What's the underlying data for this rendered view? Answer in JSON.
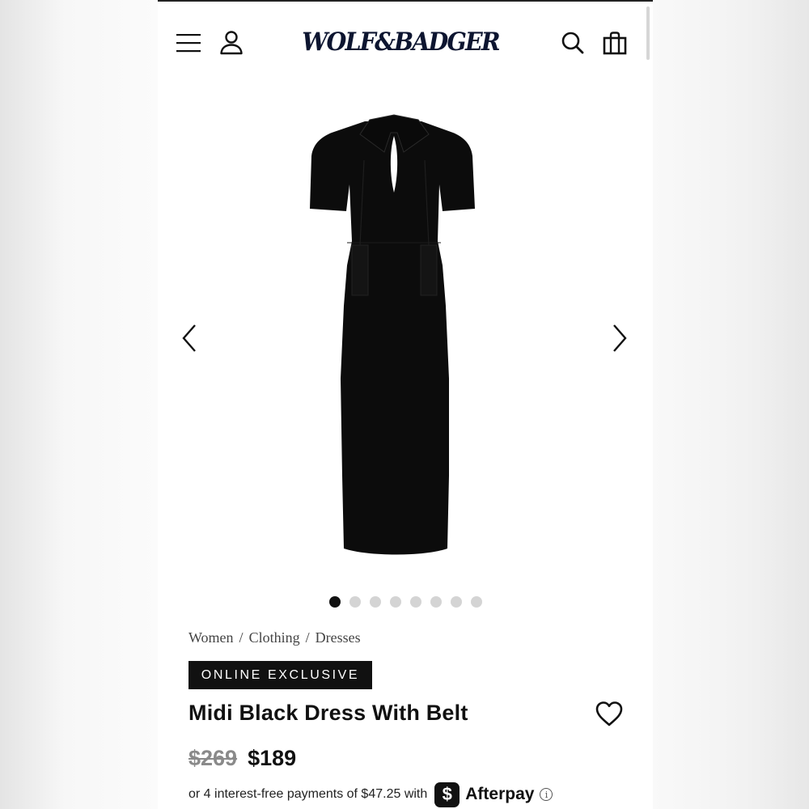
{
  "header": {
    "logo_text": "WOLF&BADGER",
    "menu_icon": "hamburger-menu-icon",
    "account_icon": "user-icon",
    "search_icon": "search-icon",
    "bag_icon": "shopping-bag-icon"
  },
  "carousel": {
    "image": "black midi dress with collar, keyhole neckline, short sleeves and waist belt",
    "prev_icon": "chevron-left-icon",
    "next_icon": "chevron-right-icon",
    "total_slides": 8,
    "active_slide": 1
  },
  "breadcrumb": {
    "items": [
      "Women",
      "Clothing",
      "Dresses"
    ],
    "separator": "/"
  },
  "product": {
    "badge": "ONLINE EXCLUSIVE",
    "title": "Midi Black Dress With Belt",
    "wishlist_icon": "heart-icon",
    "price_original": "$269",
    "price_sale": "$189"
  },
  "payment": {
    "text": "or 4 interest-free payments of $47.25 with",
    "badge_symbol": "$",
    "provider": "Afterpay",
    "info_icon_label": "i"
  },
  "colors": {
    "logo": "#0d1530",
    "badge_background": "#111111",
    "price_original": "#8a8a8a",
    "dot_inactive": "#d4d4d4",
    "dot_active": "#111111"
  }
}
